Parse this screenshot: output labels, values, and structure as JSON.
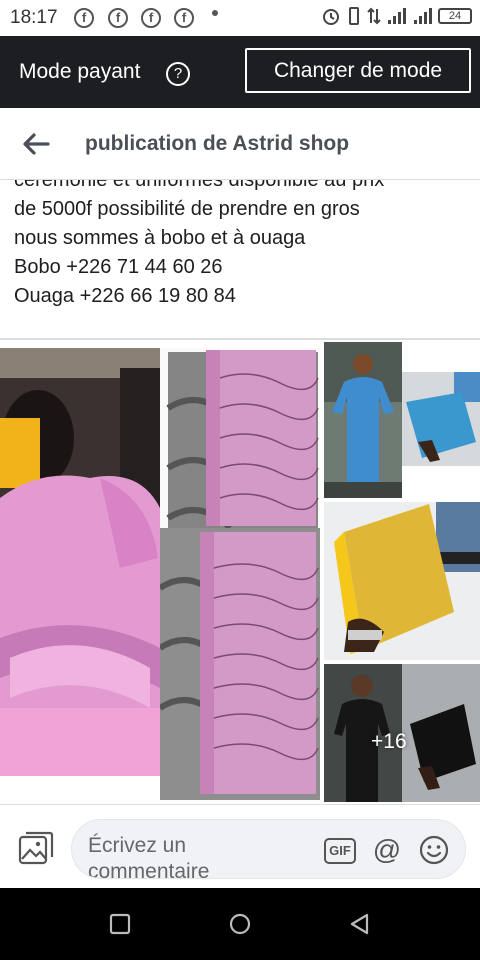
{
  "status_bar": {
    "time": "18:17",
    "notification_icons": [
      "facebook-icon",
      "facebook-icon",
      "facebook-icon",
      "facebook-icon"
    ],
    "battery_level": "24"
  },
  "mode_bar": {
    "label": "Mode payant",
    "help_icon": "question-circle-icon",
    "change_button": "Changer de mode"
  },
  "header": {
    "back_icon": "arrow-left-icon",
    "title": "publication de Astrid shop"
  },
  "post": {
    "lines": [
      "cérémonie et uniformes disponible au prix",
      "de 5000f possibilité de prendre en gros",
      "nous sommes à bobo et à ouaga",
      "Bobo +226 71 44 60 26",
      "Ouaga +226 66 19 80 84"
    ]
  },
  "photos": {
    "more_count": "+16",
    "colors": {
      "pink": "#e39ad0",
      "blue": "#3f8ccf",
      "gold": "#e0b636",
      "black": "#1a1a1a"
    }
  },
  "comment_bar": {
    "placeholder": "Écrivez un commentaire",
    "gif_label": "GIF",
    "at_label": "@"
  },
  "nav_bar": {
    "buttons": [
      "recent-apps-icon",
      "home-icon",
      "back-triangle-icon"
    ]
  }
}
